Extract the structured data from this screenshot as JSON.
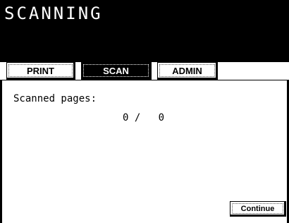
{
  "header": {
    "title": "SCANNING"
  },
  "tabs": [
    {
      "label": "PRINT",
      "active": false
    },
    {
      "label": "SCAN",
      "active": true
    },
    {
      "label": "ADMIN",
      "active": false
    }
  ],
  "main": {
    "scanned_label": "Scanned pages:",
    "scanned_count": "0",
    "count_separator": "/",
    "total_count": "0",
    "continue_label": "Continue"
  },
  "colors": {
    "background": "#ffffff",
    "header_bg": "#000000",
    "text": "#000000",
    "active_tab_bg": "#000000",
    "active_tab_text": "#ffffff"
  }
}
